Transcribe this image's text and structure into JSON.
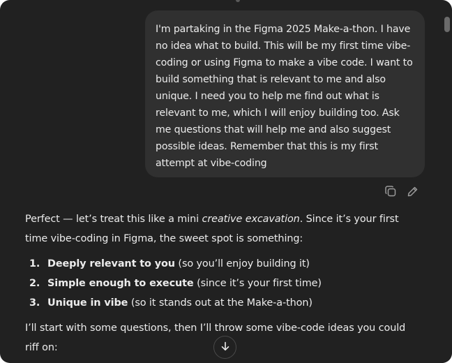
{
  "user_message": {
    "text": "I'm partaking in the Figma 2025 Make-a-thon. I have no idea what to build. This will be my first time vibe-coding or using Figma to make a vibe code. I want to build something that is relevant to me and also unique. I need you to help me find out what is relevant to me, which I will enjoy building too. Ask me questions that will help me and also suggest possible ideas. Remember that this is my first attempt at vibe-coding"
  },
  "message_actions": {
    "icons": [
      "copy-icon",
      "edit-icon"
    ]
  },
  "assistant_message": {
    "intro_before": "Perfect — let’s treat this like a mini ",
    "intro_em": "creative excavation",
    "intro_after": ". Since it’s your first time vibe-coding in Figma, the sweet spot is something:",
    "list": [
      {
        "num": "1.",
        "bold": "Deeply relevant to you",
        "rest": " (so you’ll enjoy building it)"
      },
      {
        "num": "2.",
        "bold": "Simple enough to execute",
        "rest": " (since it’s your first time)"
      },
      {
        "num": "3.",
        "bold": "Unique in vibe",
        "rest": " (so it stands out at the Make-a-thon)"
      }
    ],
    "closing": "I’ll start with some questions, then I’ll throw some vibe-code ideas you could riff on:"
  },
  "controls": {
    "scroll_down_icon": "arrow-down-icon"
  },
  "colors": {
    "background": "#212121",
    "bubble": "#303030",
    "text": "#ececec"
  }
}
